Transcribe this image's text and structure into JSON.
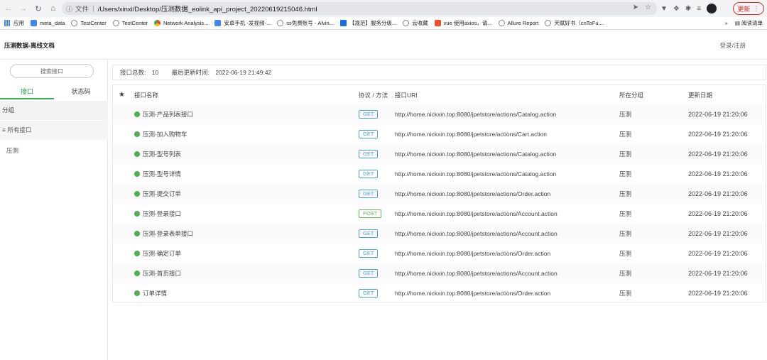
{
  "browser": {
    "url_prefix": "文件",
    "url": "/Users/xinxi/Desktop/压测数据_eolink_api_project_20220619215046.html",
    "update_label": "更新",
    "bookmarks": [
      "应用",
      "meta_data",
      "TestCenter",
      "TestCenter",
      "Network Analysis...",
      "安卓手机 -发视频-...",
      "ss免费账号 - Alvin...",
      "【规范】服务分级...",
      "云收藏",
      "vue 使用axios，请...",
      "Allure Report",
      "天赋好书（cnToFu...."
    ],
    "bookmarks_more": "»",
    "reading_list": "阅读清单"
  },
  "header": {
    "title": "压测数据-离线文档",
    "login": "登录/注册"
  },
  "sidebar": {
    "search_placeholder": "搜索接口",
    "tabs": [
      "接口",
      "状态码"
    ],
    "group_header": "分组",
    "all_apis": "所有接口",
    "groups": [
      "压测"
    ]
  },
  "summary": {
    "total_label": "接口总数:",
    "total": "10",
    "updated_label": "最后更新时间:",
    "updated": "2022-06-19 21:49:42"
  },
  "table": {
    "headers": {
      "star": "★",
      "name": "接口名称",
      "protocol": "协议 / 方法",
      "uri": "接口URI",
      "group": "所在分组",
      "date": "更新日期"
    },
    "rows": [
      {
        "name": "压测-产品列表接口",
        "method": "GET",
        "uri": "http://home.nickxin.top:8080/jpetstore/actions/Catalog.action",
        "group": "压测",
        "date": "2022-06-19 21:20:06"
      },
      {
        "name": "压测-加入购物车",
        "method": "GET",
        "uri": "http://home.nickxin.top:8080/jpetstore/actions/Cart.action",
        "group": "压测",
        "date": "2022-06-19 21:20:06"
      },
      {
        "name": "压测-型号列表",
        "method": "GET",
        "uri": "http://home.nickxin.top:8080/jpetstore/actions/Catalog.action",
        "group": "压测",
        "date": "2022-06-19 21:20:06"
      },
      {
        "name": "压测-型号详情",
        "method": "GET",
        "uri": "http://home.nickxin.top:8080/jpetstore/actions/Catalog.action",
        "group": "压测",
        "date": "2022-06-19 21:20:06"
      },
      {
        "name": "压测-提交订单",
        "method": "GET",
        "uri": "http://home.nickxin.top:8080/jpetstore/actions/Order.action",
        "group": "压测",
        "date": "2022-06-19 21:20:06"
      },
      {
        "name": "压测-登录接口",
        "method": "POST",
        "uri": "http://home.nickxin.top:8080/jpetstore/actions/Account.action",
        "group": "压测",
        "date": "2022-06-19 21:20:06"
      },
      {
        "name": "压测-登录表单接口",
        "method": "GET",
        "uri": "http://home.nickxin.top:8080/jpetstore/actions/Account.action",
        "group": "压测",
        "date": "2022-06-19 21:20:06"
      },
      {
        "name": "压测-确定订单",
        "method": "GET",
        "uri": "http://home.nickxin.top:8080/jpetstore/actions/Order.action",
        "group": "压测",
        "date": "2022-06-19 21:20:06"
      },
      {
        "name": "压测-首页接口",
        "method": "GET",
        "uri": "http://home.nickxin.top:8080/jpetstore/actions/Account.action",
        "group": "压测",
        "date": "2022-06-19 21:20:06"
      },
      {
        "name": "订单详情",
        "method": "GET",
        "uri": "http://home.nickxin.top:8080/jpetstore/actions/Order.action",
        "group": "压测",
        "date": "2022-06-19 21:20:06"
      }
    ]
  },
  "colors": {
    "accent_green": "#3aaa5b",
    "get_blue": "#4a9ee8",
    "post_green": "#5cb85c",
    "status_dot": "#4caf50"
  }
}
